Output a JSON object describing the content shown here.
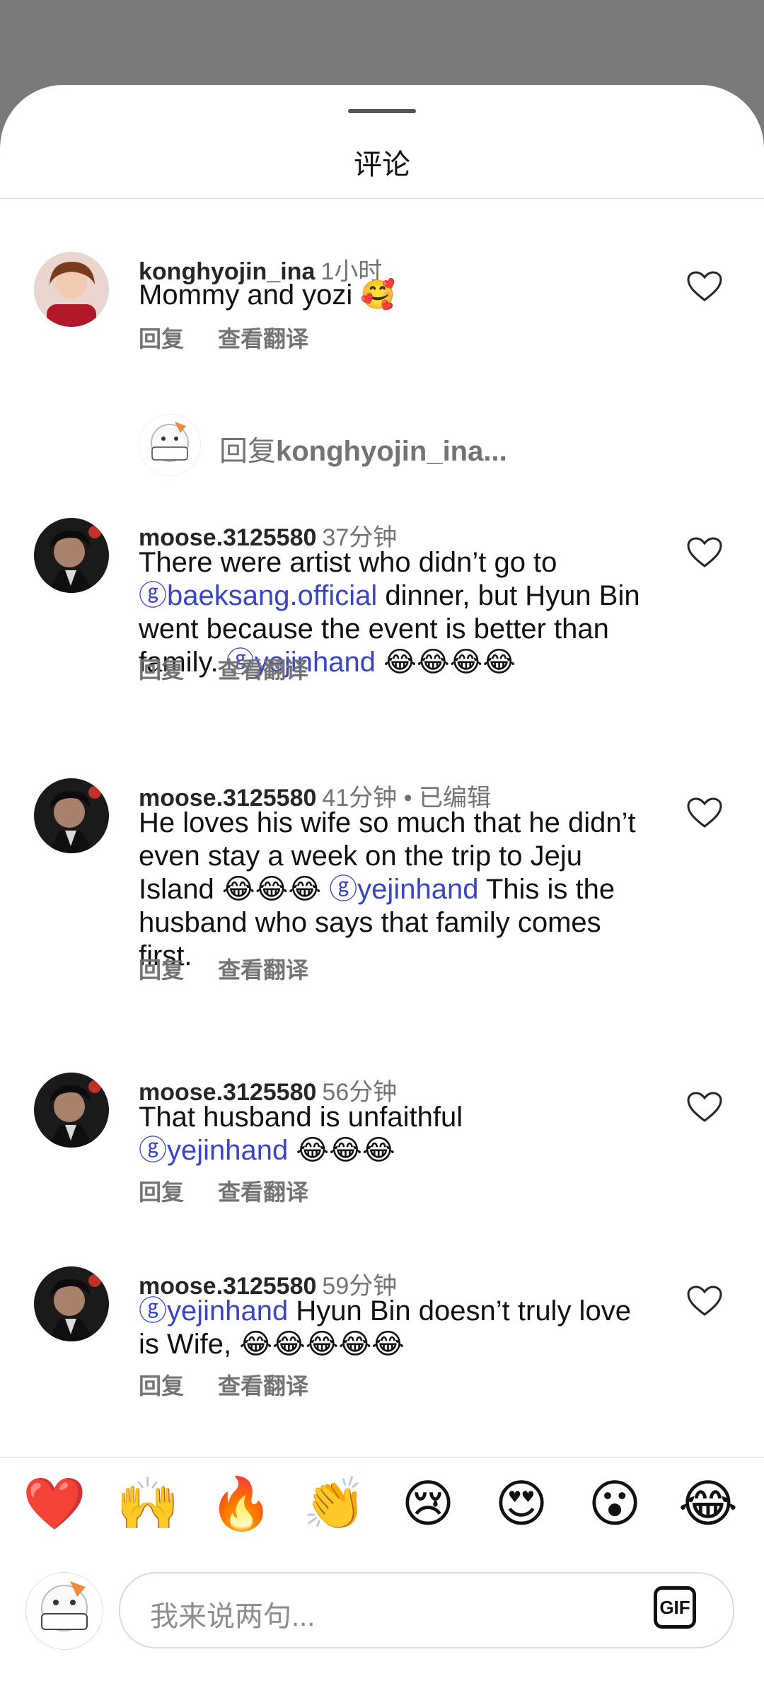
{
  "header": {
    "title": "评论"
  },
  "comments": [
    {
      "username": "konghyojin_ina",
      "time": "1小时",
      "edited": "",
      "text_parts": [
        {
          "t": "Mommy and yozi 🥰",
          "m": false
        }
      ],
      "reply": "回复",
      "translate": "查看翻译"
    },
    {
      "username": "moose.3125580",
      "time": "37分钟",
      "edited": "",
      "reply": "回复",
      "translate": "查看翻译"
    },
    {
      "username": "moose.3125580",
      "time": "41分钟",
      "edited": "• 已编辑",
      "reply": "回复",
      "translate": "查看翻译"
    },
    {
      "username": "moose.3125580",
      "time": "56分钟",
      "edited": "",
      "reply": "回复",
      "translate": "查看翻译"
    },
    {
      "username": "moose.3125580",
      "time": "59分钟",
      "edited": "",
      "reply": "回复",
      "translate": "查看翻译"
    }
  ],
  "comment_texts": {
    "c1": "Mommy and yozi 🥰",
    "c2_a": "There were artist who didn’t go to",
    "c2_mention1": "ⓖbaeksang.official",
    "c2_b": " dinner, but Hyun Bin went because the event is better than family. ",
    "c2_mention2": "ⓖyejinhand",
    "c2_c": " 😂😂😂😂",
    "c3_a": "He loves his wife so much that he didn’t even stay a week on the trip to Jeju Island 😂😂😂 ",
    "c3_mention": "ⓖyejinhand",
    "c3_b": " This is the husband who says that family comes first.",
    "c4_a": "That husband is unfaithful ",
    "c4_mention": "ⓖyejinhand",
    "c4_b": " 😂😂😂",
    "c5_mention": "ⓖyejinhand",
    "c5_a": " Hyun Bin doesn’t truly love is Wife, 😂😂😂😂😂"
  },
  "reply_prompt": {
    "prefix": "回复",
    "username": "konghyojin_ina..."
  },
  "quick_emojis": [
    "❤️",
    "🙌",
    "🔥",
    "👏",
    "😢",
    "😍",
    "😮",
    "😂"
  ],
  "composer": {
    "placeholder": "我来说两句...",
    "gif_label": "GIF"
  }
}
